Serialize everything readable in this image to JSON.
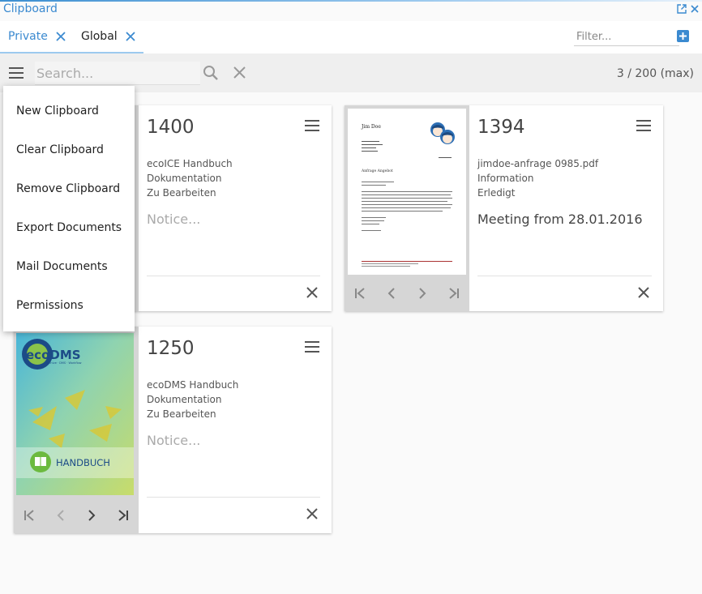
{
  "app": {
    "title": "Clipboard"
  },
  "tabs": [
    {
      "label": "Private"
    },
    {
      "label": "Global"
    }
  ],
  "filter": {
    "placeholder": "Filter..."
  },
  "search": {
    "placeholder": "Search...",
    "value": ""
  },
  "toolbar": {
    "count": "3 / 200 (max)"
  },
  "menu": {
    "items": [
      {
        "label": "New Clipboard"
      },
      {
        "label": "Clear Clipboard"
      },
      {
        "label": "Remove Clipboard"
      },
      {
        "label": "Export Documents"
      },
      {
        "label": "Mail Documents"
      },
      {
        "label": "Permissions"
      }
    ]
  },
  "cards": [
    {
      "number": "1400",
      "title": "ecoICE Handbuch",
      "type": "Dokumentation",
      "status": "Zu Bearbeiten",
      "notice": "",
      "notice_placeholder": "Notice..."
    },
    {
      "number": "1394",
      "title": "jimdoe-anfrage 0985.pdf",
      "type": "Information",
      "status": "Erledigt",
      "notice": "Meeting from 28.01.2016",
      "notice_placeholder": "Notice...",
      "preview": {
        "header": "Jim Doe",
        "subject": "Anfrage Angebot"
      }
    },
    {
      "number": "1250",
      "title": "ecoDMS Handbuch",
      "type": "Dokumentation",
      "status": "Zu Bearbeiten",
      "notice": "",
      "notice_placeholder": "Notice...",
      "preview": {
        "logo": "ecoDMS",
        "tagline": "archive · DMS · Workflow",
        "banner": "HANDBUCH"
      }
    }
  ],
  "colors": {
    "accent": "#3b8ad0",
    "toolbar_bg": "#efefef",
    "thumb_bg": "#d6d6d6"
  }
}
